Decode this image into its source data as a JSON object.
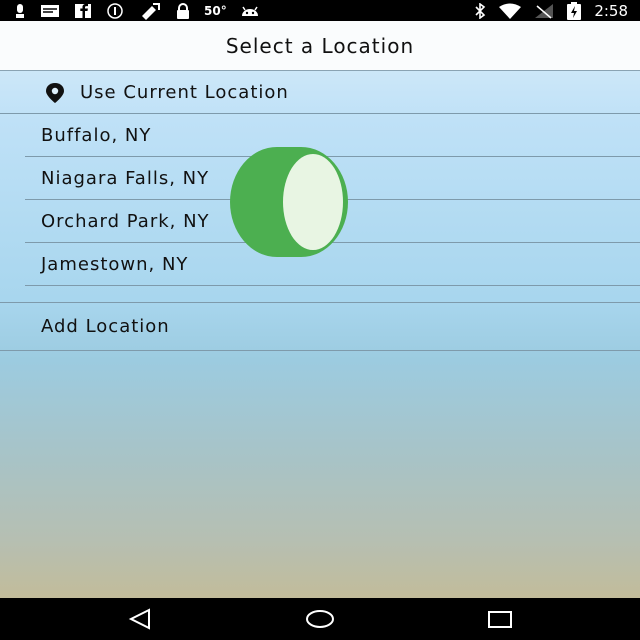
{
  "status_bar": {
    "temperature": "50°",
    "time": "2:58",
    "icons_left": [
      "alert-icon",
      "message-icon",
      "facebook-icon",
      "info-icon",
      "satellite-icon",
      "lock-icon",
      "android-icon"
    ],
    "icons_right": [
      "bluetooth-icon",
      "wifi-icon",
      "signal-icon",
      "battery-charging-icon"
    ]
  },
  "header": {
    "title": "Select a Location"
  },
  "locations": {
    "current": "Use Current Location",
    "items": [
      {
        "label": "Buffalo, NY"
      },
      {
        "label": "Niagara Falls, NY"
      },
      {
        "label": "Orchard Park, NY"
      },
      {
        "label": "Jamestown, NY"
      }
    ],
    "add_label": "Add Location"
  },
  "overlay": {
    "icon": "green-toggle-blob-icon",
    "color": "#4caf50",
    "inner_color": "#e8f5e3"
  },
  "nav_bar": {
    "buttons": [
      "back-icon",
      "home-icon",
      "recents-icon"
    ]
  },
  "colors": {
    "accent_green": "#4caf50",
    "divider": "#7e9aab"
  }
}
